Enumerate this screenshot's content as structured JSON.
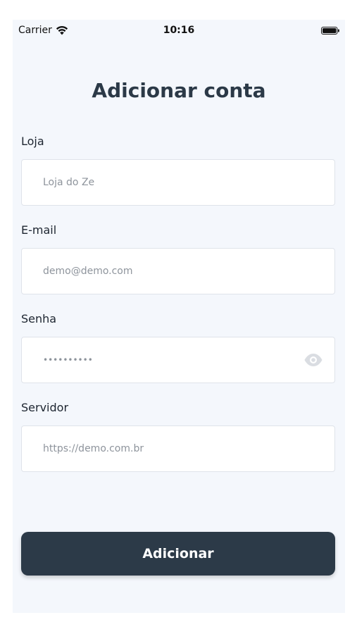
{
  "status_bar": {
    "carrier": "Carrier",
    "time": "10:16",
    "wifi_icon": "wifi-icon",
    "battery_icon": "battery-icon"
  },
  "header": {
    "title": "Adicionar conta"
  },
  "form": {
    "store": {
      "label": "Loja",
      "placeholder": "Loja do Ze"
    },
    "email": {
      "label": "E-mail",
      "placeholder": "demo@demo.com"
    },
    "password": {
      "label": "Senha",
      "value": "••••••••••",
      "toggle_icon": "eye-icon"
    },
    "server": {
      "label": "Servidor",
      "placeholder": "https://demo.com.br"
    }
  },
  "actions": {
    "submit_label": "Adicionar"
  },
  "colors": {
    "background": "#f4f7fc",
    "title": "#2b3947",
    "button": "#2c3a48",
    "button_text": "#ffffff",
    "field_border": "#dfe3ea",
    "placeholder": "#8e949c"
  }
}
